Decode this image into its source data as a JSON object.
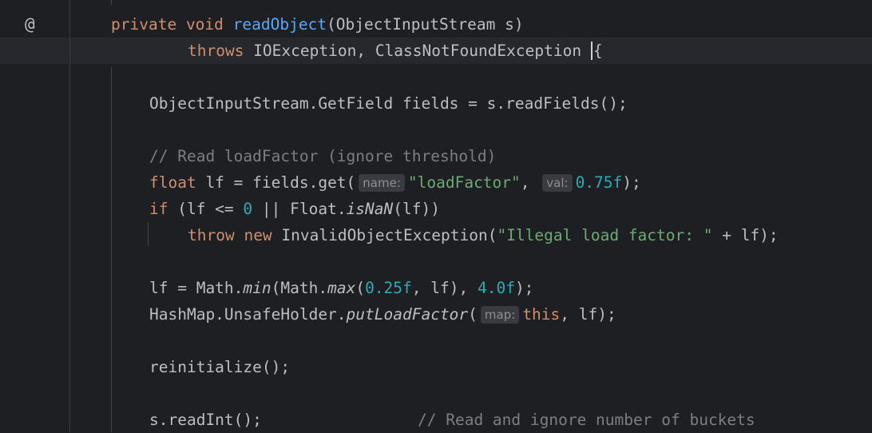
{
  "gutter": {
    "marker": "@"
  },
  "code": {
    "l1": {
      "mod": "private",
      "type": "void",
      "name": "readObject",
      "rest": "(ObjectInputStream s)"
    },
    "l2": {
      "kw": "throws",
      "rest": " IOException, ClassNotFoundException ",
      "brace": "{"
    },
    "l3": {
      "text": "ObjectInputStream.GetField fields = s.readFields();"
    },
    "l4": {
      "comment": "// Read loadFactor (ignore threshold)"
    },
    "l5": {
      "type": "float",
      "p1": " lf = fields.get(",
      "hint1": "name:",
      "str": "\"loadFactor\"",
      "p2": ", ",
      "hint2": "val:",
      "num": "0.75f",
      "p3": ");"
    },
    "l6": {
      "kw": "if",
      "p1": " (lf <= ",
      "num": "0",
      "p2": " || Float.",
      "method": "isNaN",
      "p3": "(lf))"
    },
    "l7": {
      "kw1": "throw",
      "kw2": "new",
      "p1": " InvalidObjectException(",
      "str": "\"Illegal load factor: \"",
      "p2": " + lf);"
    },
    "l8": {
      "p1": "lf = Math.",
      "m1": "min",
      "p2": "(Math.",
      "m2": "max",
      "p3": "(",
      "n1": "0.25f",
      "p4": ", lf), ",
      "n2": "4.0f",
      "p5": ");"
    },
    "l9": {
      "p1": "HashMap.UnsafeHolder.",
      "method": "putLoadFactor",
      "p2": "(",
      "hint": "map:",
      "kw": "this",
      "p3": ", lf);"
    },
    "l10": {
      "text": "reinitialize();"
    },
    "l11": {
      "text": "s.readInt();",
      "comment": "// Read and ignore number of buckets"
    }
  }
}
